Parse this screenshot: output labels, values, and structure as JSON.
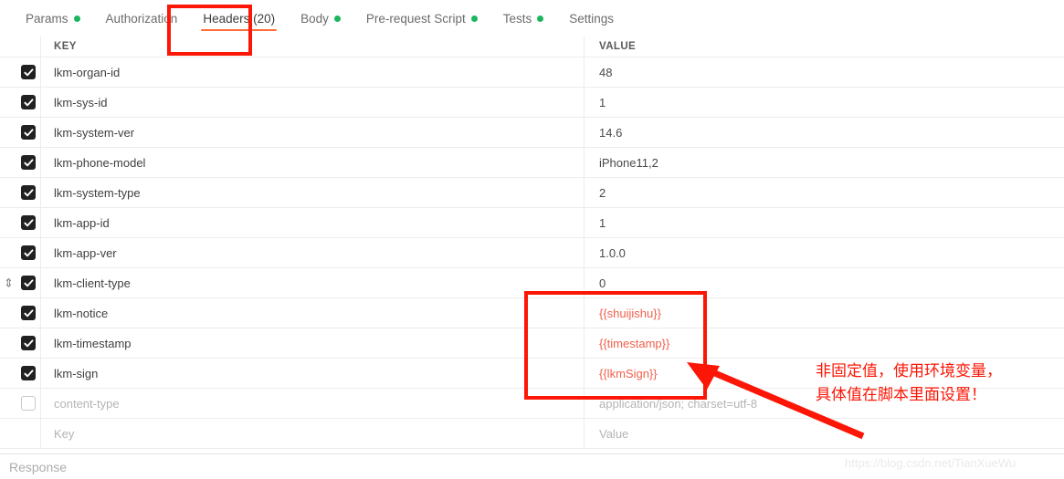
{
  "tabs": [
    {
      "label": "Params",
      "dot": true,
      "active": false
    },
    {
      "label": "Authorization",
      "dot": false,
      "active": false
    },
    {
      "label": "Headers (20)",
      "dot": false,
      "active": true
    },
    {
      "label": "Body",
      "dot": true,
      "active": false
    },
    {
      "label": "Pre-request Script",
      "dot": true,
      "active": false
    },
    {
      "label": "Tests",
      "dot": true,
      "active": false
    },
    {
      "label": "Settings",
      "dot": false,
      "active": false
    }
  ],
  "table": {
    "headers": {
      "key": "KEY",
      "value": "VALUE"
    },
    "rows": [
      {
        "checked": true,
        "handle": false,
        "key": "lkm-organ-id",
        "value": "48",
        "muted": false,
        "tpl": false
      },
      {
        "checked": true,
        "handle": false,
        "key": "lkm-sys-id",
        "value": "1",
        "muted": false,
        "tpl": false
      },
      {
        "checked": true,
        "handle": false,
        "key": "lkm-system-ver",
        "value": "14.6",
        "muted": false,
        "tpl": false
      },
      {
        "checked": true,
        "handle": false,
        "key": "lkm-phone-model",
        "value": "iPhone11,2",
        "muted": false,
        "tpl": false
      },
      {
        "checked": true,
        "handle": false,
        "key": "lkm-system-type",
        "value": "2",
        "muted": false,
        "tpl": false
      },
      {
        "checked": true,
        "handle": false,
        "key": "lkm-app-id",
        "value": "1",
        "muted": false,
        "tpl": false
      },
      {
        "checked": true,
        "handle": false,
        "key": "lkm-app-ver",
        "value": "1.0.0",
        "muted": false,
        "tpl": false
      },
      {
        "checked": true,
        "handle": true,
        "key": "lkm-client-type",
        "value": "0",
        "muted": false,
        "tpl": false
      },
      {
        "checked": true,
        "handle": false,
        "key": "lkm-notice",
        "value": "{{shuijishu}}",
        "muted": false,
        "tpl": true
      },
      {
        "checked": true,
        "handle": false,
        "key": "lkm-timestamp",
        "value": "{{timestamp}}",
        "muted": false,
        "tpl": true
      },
      {
        "checked": true,
        "handle": false,
        "key": "lkm-sign",
        "value": "{{lkmSign}}",
        "muted": false,
        "tpl": true
      },
      {
        "checked": false,
        "handle": false,
        "key": "content-type",
        "value": "application/json; charset=utf-8",
        "muted": true,
        "tpl": false
      },
      {
        "checked": null,
        "handle": false,
        "key": "Key",
        "value": "Value",
        "muted": true,
        "tpl": false
      }
    ]
  },
  "response": {
    "label": "Response"
  },
  "annotations": {
    "note_line1": "非固定值，使用环境变量，",
    "note_line2": "具体值在脚本里面设置！",
    "highlight_color": "#fc1605"
  },
  "watermark": {
    "text": "https://blog.csdn.net/TianXueWu"
  },
  "icons": {
    "drag_handle": "⇕",
    "check": "check-icon"
  },
  "colors": {
    "accent": "#ff6c37",
    "dot": "#1bb55c",
    "template_var": "#f0604d",
    "annotation": "#fc1605"
  }
}
